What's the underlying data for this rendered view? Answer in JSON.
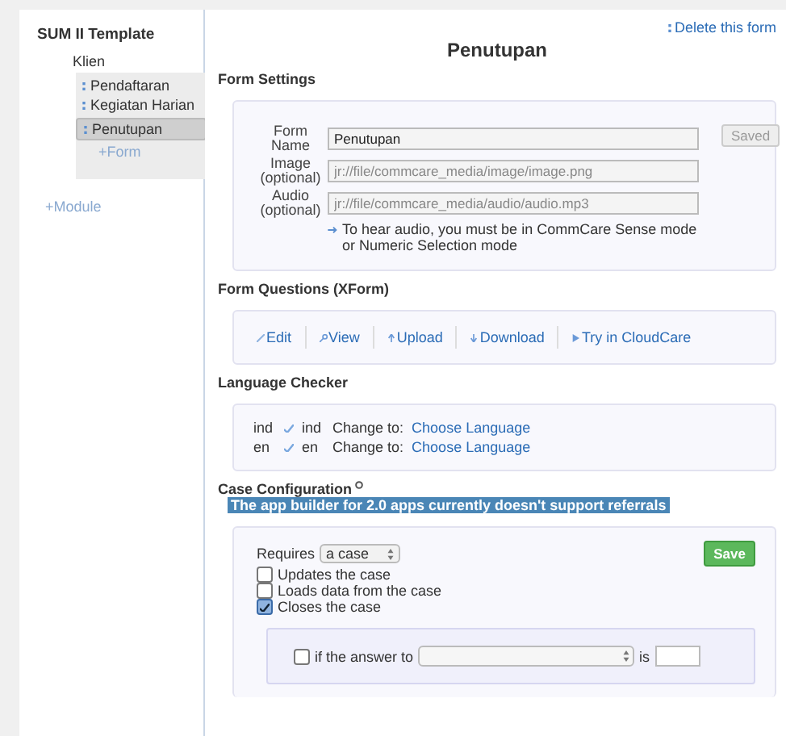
{
  "sidebar": {
    "title": "SUM II Template",
    "module": "Klien",
    "forms": [
      {
        "label": "Pendaftaran",
        "selected": false
      },
      {
        "label": "Kegiatan Harian",
        "selected": false
      },
      {
        "label": "Penutupan",
        "selected": true
      }
    ],
    "add_form": "+Form",
    "add_module": "+Module"
  },
  "delete_link": "Delete this form",
  "title": "Penutupan",
  "form_settings": {
    "heading": "Form Settings",
    "fields": [
      {
        "label": "Form Name",
        "value": "Penutupan",
        "disabled": false
      },
      {
        "label": "Image (optional)",
        "value": "jr://file/commcare_media/image/image.png",
        "disabled": true
      },
      {
        "label": "Audio (optional)",
        "value": "jr://file/commcare_media/audio/audio.mp3",
        "disabled": true
      }
    ],
    "audio_note": "To hear audio, you must be in CommCare Sense mode or Numeric Selection mode",
    "saved_button": "Saved"
  },
  "form_questions": {
    "heading": "Form Questions (XForm)",
    "actions": [
      "Edit",
      "View",
      "Upload",
      "Download",
      "Try in CloudCare"
    ]
  },
  "language_checker": {
    "heading": "Language Checker",
    "rows": [
      {
        "code": "ind",
        "target": "ind",
        "change_to": "Change to:",
        "link": "Choose Language"
      },
      {
        "code": "en",
        "target": "en",
        "change_to": "Change to:",
        "link": "Choose Language"
      }
    ]
  },
  "case_configuration": {
    "heading": "Case Configuration",
    "notice": "The app builder for 2.0 apps currently doesn't support referrals",
    "requires_label": "Requires",
    "requires_value": "a case",
    "save_button": "Save",
    "options": [
      {
        "label": "Updates the case",
        "checked": false
      },
      {
        "label": "Loads data from the case",
        "checked": false
      },
      {
        "label": "Closes the case",
        "checked": true
      }
    ],
    "condition": {
      "checked": false,
      "prefix": "if the answer to",
      "suffix": "is"
    }
  }
}
